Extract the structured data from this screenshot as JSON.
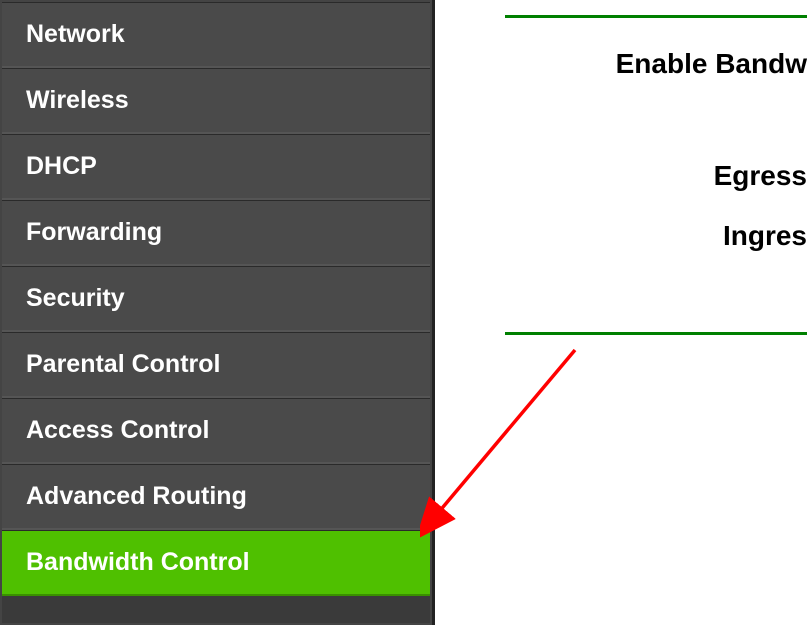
{
  "sidebar": {
    "items": [
      {
        "label": "Network"
      },
      {
        "label": "Wireless"
      },
      {
        "label": "DHCP"
      },
      {
        "label": "Forwarding"
      },
      {
        "label": "Security"
      },
      {
        "label": "Parental Control"
      },
      {
        "label": "Access Control"
      },
      {
        "label": "Advanced Routing"
      },
      {
        "label": "Bandwidth Control"
      }
    ],
    "active_index": 8
  },
  "content": {
    "enable_label": "Enable Bandw",
    "egress_label": "Egress",
    "ingress_label": "Ingres"
  },
  "colors": {
    "accent_green": "#4fc000",
    "line_green": "#008000",
    "sidebar_bg": "#4a4a4a",
    "arrow_red": "#ff0000"
  }
}
